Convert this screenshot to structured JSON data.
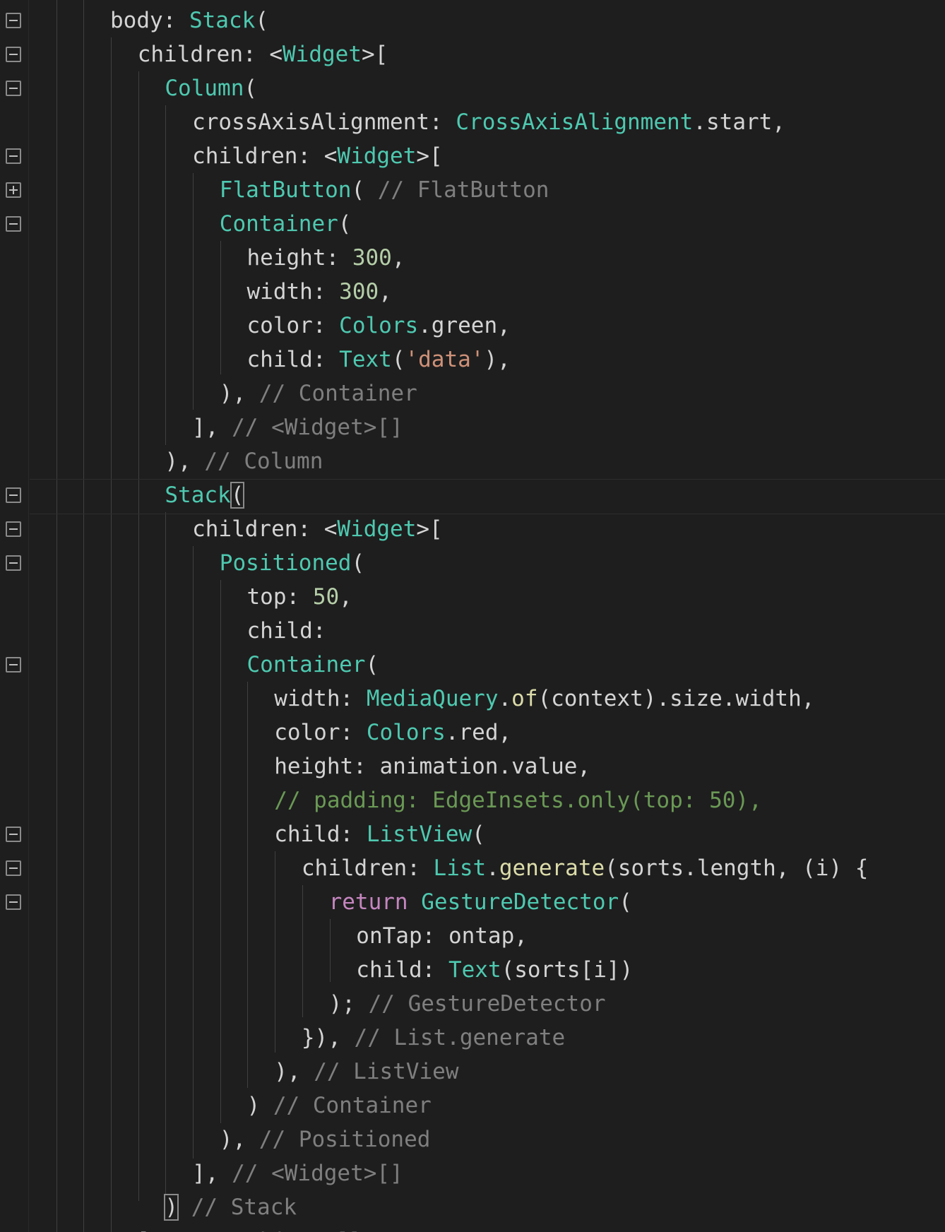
{
  "code_lines": [
    [
      {
        "t": "body: ",
        "c": "p"
      },
      {
        "t": "Stack",
        "c": "k"
      },
      {
        "t": "(",
        "c": "p"
      }
    ],
    [
      {
        "t": "children: <",
        "c": "p"
      },
      {
        "t": "Widget",
        "c": "k"
      },
      {
        "t": ">[",
        "c": "p"
      }
    ],
    [
      {
        "t": "Column",
        "c": "k"
      },
      {
        "t": "(",
        "c": "p"
      }
    ],
    [
      {
        "t": "crossAxisAlignment: ",
        "c": "p"
      },
      {
        "t": "CrossAxisAlignment",
        "c": "k"
      },
      {
        "t": ".start,",
        "c": "p"
      }
    ],
    [
      {
        "t": "children: <",
        "c": "p"
      },
      {
        "t": "Widget",
        "c": "k"
      },
      {
        "t": ">[",
        "c": "p"
      }
    ],
    [
      {
        "t": "FlatButton",
        "c": "k"
      },
      {
        "t": "( ",
        "c": "p"
      },
      {
        "t": "// FlatButton",
        "c": "c"
      }
    ],
    [
      {
        "t": "Container",
        "c": "k"
      },
      {
        "t": "(",
        "c": "p"
      }
    ],
    [
      {
        "t": "height: ",
        "c": "p"
      },
      {
        "t": "300",
        "c": "n"
      },
      {
        "t": ",",
        "c": "p"
      }
    ],
    [
      {
        "t": "width: ",
        "c": "p"
      },
      {
        "t": "300",
        "c": "n"
      },
      {
        "t": ",",
        "c": "p"
      }
    ],
    [
      {
        "t": "color: ",
        "c": "p"
      },
      {
        "t": "Colors",
        "c": "k"
      },
      {
        "t": ".green,",
        "c": "p"
      }
    ],
    [
      {
        "t": "child: ",
        "c": "p"
      },
      {
        "t": "Text",
        "c": "k"
      },
      {
        "t": "(",
        "c": "p"
      },
      {
        "t": "'data'",
        "c": "s"
      },
      {
        "t": "),",
        "c": "p"
      }
    ],
    [
      {
        "t": "), ",
        "c": "p"
      },
      {
        "t": "// Container",
        "c": "c"
      }
    ],
    [
      {
        "t": "], ",
        "c": "p"
      },
      {
        "t": "// <Widget>[]",
        "c": "c"
      }
    ],
    [
      {
        "t": "), ",
        "c": "p"
      },
      {
        "t": "// Column",
        "c": "c"
      }
    ],
    [
      {
        "t": "Stack",
        "c": "k"
      },
      {
        "t": "(",
        "c": "br"
      }
    ],
    [
      {
        "t": "children: <",
        "c": "p"
      },
      {
        "t": "Widget",
        "c": "k"
      },
      {
        "t": ">[",
        "c": "p"
      }
    ],
    [
      {
        "t": "Positioned",
        "c": "k"
      },
      {
        "t": "(",
        "c": "p"
      }
    ],
    [
      {
        "t": "top: ",
        "c": "p"
      },
      {
        "t": "50",
        "c": "n"
      },
      {
        "t": ",",
        "c": "p"
      }
    ],
    [
      {
        "t": "child:",
        "c": "p"
      }
    ],
    [
      {
        "t": "Container",
        "c": "k"
      },
      {
        "t": "(",
        "c": "p"
      }
    ],
    [
      {
        "t": "width: ",
        "c": "p"
      },
      {
        "t": "MediaQuery",
        "c": "k"
      },
      {
        "t": ".",
        "c": "p"
      },
      {
        "t": "of",
        "c": "f"
      },
      {
        "t": "(context).size.width,",
        "c": "p"
      }
    ],
    [
      {
        "t": "color: ",
        "c": "p"
      },
      {
        "t": "Colors",
        "c": "k"
      },
      {
        "t": ".red,",
        "c": "p"
      }
    ],
    [
      {
        "t": "height: animation.value,",
        "c": "p"
      }
    ],
    [
      {
        "t": "// padding: EdgeInsets.only(top: 50),",
        "c": "cg"
      }
    ],
    [
      {
        "t": "child: ",
        "c": "p"
      },
      {
        "t": "ListView",
        "c": "k"
      },
      {
        "t": "(",
        "c": "p"
      }
    ],
    [
      {
        "t": "children: ",
        "c": "p"
      },
      {
        "t": "List",
        "c": "k"
      },
      {
        "t": ".",
        "c": "p"
      },
      {
        "t": "generate",
        "c": "f"
      },
      {
        "t": "(sorts.length, (i) {",
        "c": "p"
      }
    ],
    [
      {
        "t": "return ",
        "c": "r"
      },
      {
        "t": "GestureDetector",
        "c": "k"
      },
      {
        "t": "(",
        "c": "p"
      }
    ],
    [
      {
        "t": "onTap: ontap,",
        "c": "p"
      }
    ],
    [
      {
        "t": "child: ",
        "c": "p"
      },
      {
        "t": "Text",
        "c": "k"
      },
      {
        "t": "(sorts[i])",
        "c": "p"
      }
    ],
    [
      {
        "t": "); ",
        "c": "p"
      },
      {
        "t": "// GestureDetector",
        "c": "c"
      }
    ],
    [
      {
        "t": "}), ",
        "c": "p"
      },
      {
        "t": "// List.generate",
        "c": "c"
      }
    ],
    [
      {
        "t": "), ",
        "c": "p"
      },
      {
        "t": "// ListView",
        "c": "c"
      }
    ],
    [
      {
        "t": ") ",
        "c": "p"
      },
      {
        "t": "// Container",
        "c": "c"
      }
    ],
    [
      {
        "t": "), ",
        "c": "p"
      },
      {
        "t": "// Positioned",
        "c": "c"
      }
    ],
    [
      {
        "t": "], ",
        "c": "p"
      },
      {
        "t": "// <Widget>[]",
        "c": "c"
      }
    ],
    [
      {
        "t": ")",
        "c": "br"
      },
      {
        "t": " ",
        "c": "p"
      },
      {
        "t": "// Stack",
        "c": "c"
      }
    ],
    [
      {
        "t": "],  ",
        "c": "p"
      },
      {
        "t": "// <Widget>[]",
        "c": "c"
      }
    ]
  ],
  "fold_markers": [
    "minus",
    "minus",
    "minus",
    "none",
    "minus",
    "plus",
    "minus",
    "none",
    "none",
    "none",
    "none",
    "none",
    "none",
    "none",
    "minus",
    "minus",
    "minus",
    "none",
    "none",
    "minus",
    "none",
    "none",
    "none",
    "none",
    "minus",
    "minus",
    "minus",
    "none",
    "none",
    "none",
    "none",
    "none",
    "none",
    "none",
    "none",
    "none",
    "none"
  ]
}
